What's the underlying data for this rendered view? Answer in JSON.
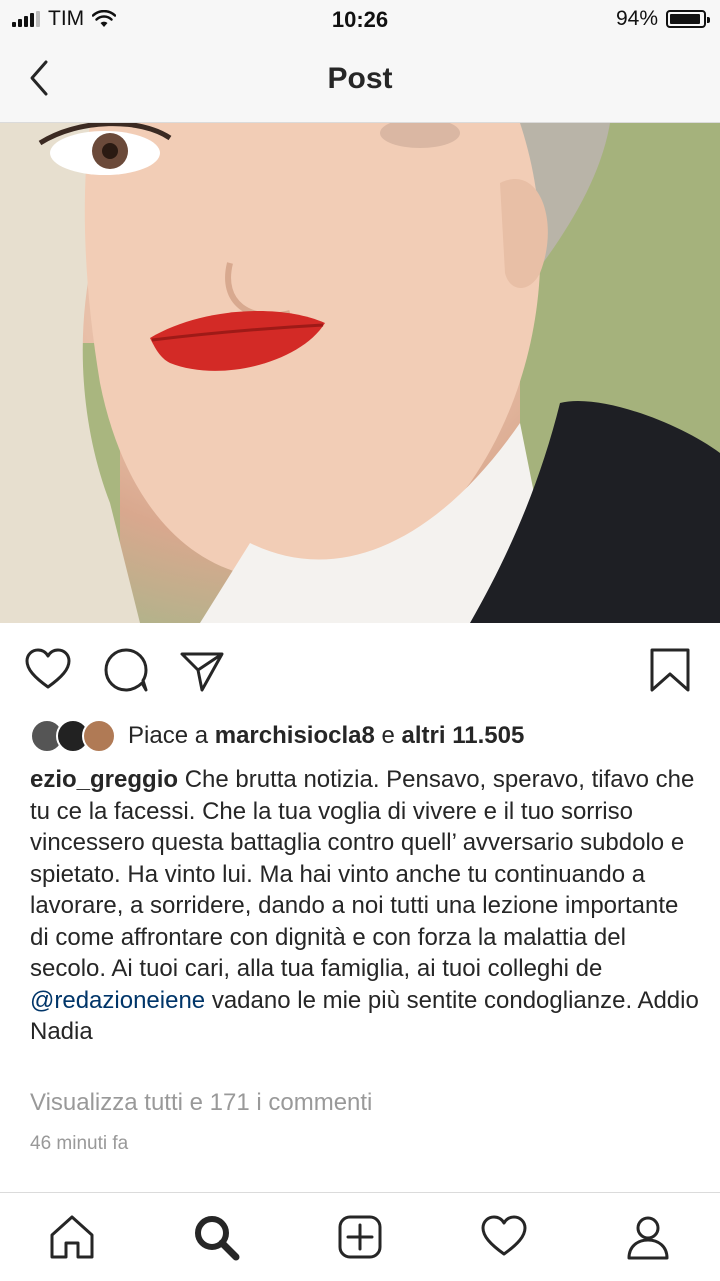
{
  "status": {
    "carrier": "TIM",
    "time": "10:26",
    "battery": "94%",
    "battery_level": 0.94
  },
  "nav": {
    "title": "Post",
    "back_icon": "chevron-left-icon"
  },
  "post": {
    "photo_icon": "post-photo",
    "actions": [
      "heart-icon",
      "comment-icon",
      "share-icon",
      "bookmark-icon"
    ],
    "likes": {
      "prefix": "Piace a",
      "user": "marchisiocla8",
      "connector": "e",
      "others": "altri 11.505"
    },
    "caption": {
      "username": "ezio_greggio",
      "text_before": "Che brutta notizia. Pensavo, speravo, tifavo che tu ce la facessi. Che la tua voglia di vivere e il tuo sorriso vincessero questa battaglia contro quell’ avversario subdolo e spietato. Ha vinto lui. Ma hai vinto anche tu continuando a lavorare, a sorridere, dando a noi tutti una lezione importante di come affrontare con dignità e con forza la malattia del secolo. Ai tuoi cari, alla tua famiglia, ai tuoi colleghi de",
      "mention": "@redazioneiene",
      "text_after": "vadano le mie più sentite condoglianze. Addio Nadia"
    },
    "view_comments": "Visualizza tutti e 171 i commenti",
    "timestamp": "46 minuti fa"
  },
  "tabs": [
    "home-icon",
    "search-icon",
    "add-icon",
    "activity-icon",
    "profile-icon"
  ],
  "colors": {
    "mention": "#003569",
    "muted": "#999999",
    "text": "#262626"
  }
}
